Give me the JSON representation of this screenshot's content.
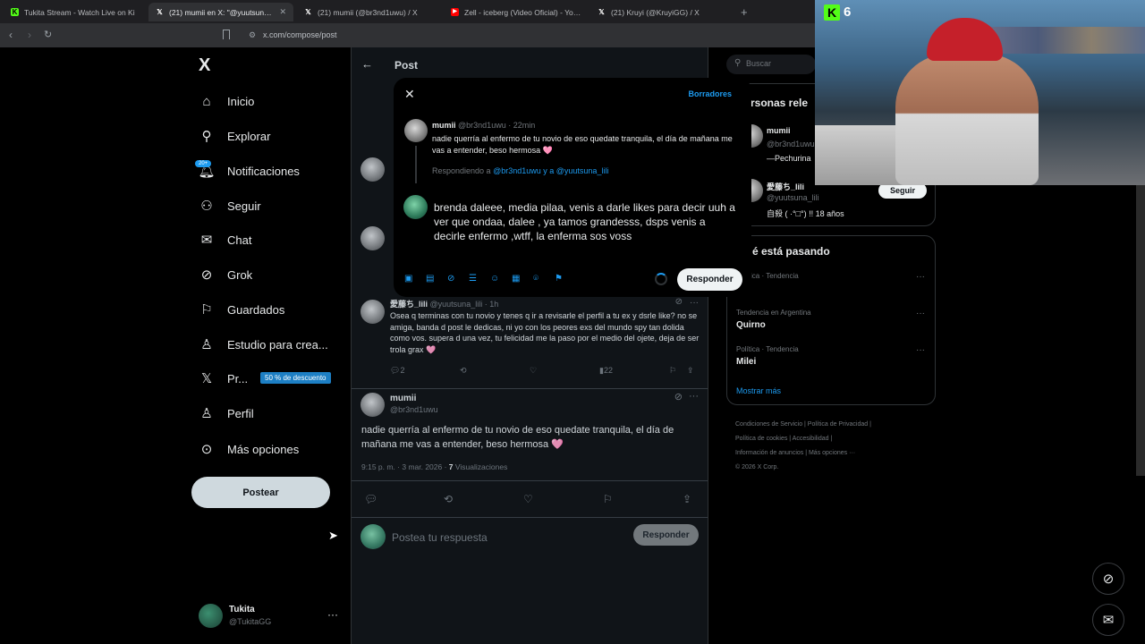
{
  "browser": {
    "tabs": [
      {
        "title": "Tukita Stream - Watch Live on Ki",
        "favicon": "kick-icon",
        "color": "#53fc18"
      },
      {
        "title": "(21) mumii en X: \"@yuutsuna_lili",
        "favicon": "x-icon",
        "color": "#ffffff"
      },
      {
        "title": "(21) mumii (@br3nd1uwu) / X",
        "favicon": "x-icon",
        "color": "#ffffff"
      },
      {
        "title": "Zell - iceberg (Video Oficial) - YouTub",
        "favicon": "youtube-icon",
        "color": "#ff0000"
      },
      {
        "title": "(21) Kruyi (@KruyiGG) / X",
        "favicon": "x-icon",
        "color": "#ffffff"
      }
    ],
    "new_tab": "+",
    "url": "x.com/compose/post"
  },
  "sidebar": {
    "logo": "X",
    "items": [
      {
        "label": "Inicio",
        "icon": "home-icon"
      },
      {
        "label": "Explorar",
        "icon": "search-icon"
      },
      {
        "label": "Notificaciones",
        "icon": "bell-icon"
      },
      {
        "label": "Seguir",
        "icon": "person-add-icon"
      },
      {
        "label": "Chat",
        "icon": "mail-icon"
      },
      {
        "label": "Grok",
        "icon": "grok-icon"
      },
      {
        "label": "Guardados",
        "icon": "bookmark-icon"
      },
      {
        "label": "Estudio para crea...",
        "icon": "studio-icon"
      },
      {
        "label": "Pr...",
        "icon": "x-premium-icon"
      },
      {
        "label": "Perfil",
        "icon": "profile-icon"
      },
      {
        "label": "Más opciones",
        "icon": "more-circle-icon"
      }
    ],
    "notif_badge": "20+",
    "promo": "50 % de descuento",
    "post_button": "Postear",
    "account": {
      "name": "Tukita",
      "handle": "@TukitaGG"
    }
  },
  "center": {
    "header": "Post",
    "reply_tweet": {
      "name": "愛藤ち_lili",
      "meta": "@yuutsuna_lili · 1h",
      "text": "Osea q terminas con tu novio y tenes q ir a revisarle el perfil a tu ex y dsrle like? no se amiga, banda d post le dedicas, ni yo con los peores exs del mundo spy tan dolida como vos. supera d una vez, tu felicidad me la paso por el medio del ojete, deja de ser trola grax 🩷",
      "replies": "2",
      "views": "22"
    },
    "main_tweet": {
      "name": "mumii",
      "handle": "@br3nd1uwu",
      "text": "nadie querría al enfermo de tu novio de eso quedate tranquila, el día de mañana me vas a entender, beso hermosa 🩷",
      "time": "9:15 p. m. · 3 mar. 2026 · ",
      "views_count": "7",
      "views_label": " Visualizaciones"
    },
    "reply_placeholder": "Postea tu respuesta",
    "reply_button": "Responder"
  },
  "modal": {
    "drafts": "Borradores",
    "quoted": {
      "name": "mumii",
      "meta": "@br3nd1uwu · 22min",
      "text": "nadie querría al enfermo de tu novio de eso quedate tranquila, el día de mañana me vas a entender, beso hermosa 🩷",
      "replying_prefix": "Respondiendo a ",
      "replying_to": "@br3nd1uwu y a @yuutsuna_lili"
    },
    "draft_text": "brenda daleee, media pilaa, venis a darle likes para decir uuh a ver que ondaa, dalee , ya tamos grandesss, dsps venis a decirle enfermo ,wtff, la enferma sos voss",
    "reply_button": "Responder"
  },
  "right": {
    "search_placeholder": "Buscar",
    "who_title": "rsonas rele",
    "who": [
      {
        "name": "mumii",
        "handle": "@br3nd1uwu",
        "bio": "—Pechurina"
      },
      {
        "name": "愛藤ち_lili",
        "handle": "@yuutsuna_lili",
        "bio": "自殺 ( ·°□°) !! 18 años"
      }
    ],
    "follow": "Seguir",
    "trends_title": "é está pasando",
    "trends": [
      {
        "cat": "Política · Tendencia",
        "name": "I"
      },
      {
        "cat": "Tendencia en Argentina",
        "name": "Quirno"
      },
      {
        "cat": "Política · Tendencia",
        "name": "Milei"
      }
    ],
    "show_more": "Mostrar más",
    "footer_lines": [
      "Condiciones de Servicio  |  Política de Privacidad  |",
      "Política de cookies  |  Accesibilidad  |",
      "Información de anuncios  |  Más opciones ···",
      "© 2026 X Corp."
    ]
  },
  "stream": {
    "viewer_count": "6"
  }
}
